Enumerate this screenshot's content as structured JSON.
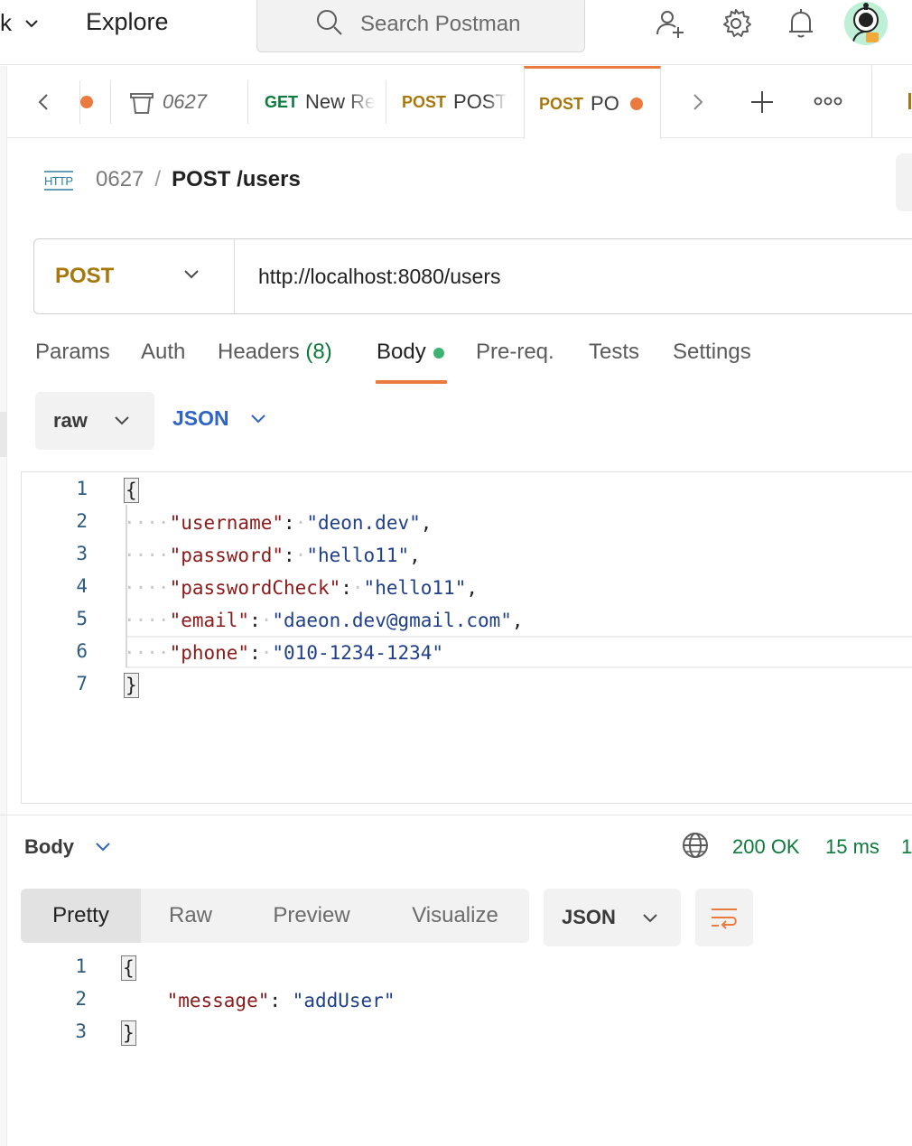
{
  "topbar": {
    "workspace_fragment": "k",
    "explore_label": "Explore",
    "search_placeholder": "Search Postman"
  },
  "tabs": [
    {
      "label": "0627"
    },
    {
      "method": "GET",
      "label": "New Re"
    },
    {
      "method": "POST",
      "label": "POST"
    },
    {
      "method": "POST",
      "label": "PO"
    }
  ],
  "breadcrumb": {
    "collection": "0627",
    "separator": "/",
    "request": "POST /users"
  },
  "request": {
    "method": "POST",
    "url": "http://localhost:8080/users"
  },
  "request_tabs": {
    "params": "Params",
    "auth": "Auth",
    "headers": "Headers",
    "headers_count": "(8)",
    "body": "Body",
    "prereq": "Pre-req.",
    "tests": "Tests",
    "settings": "Settings"
  },
  "body_mode": {
    "type": "raw",
    "language": "JSON"
  },
  "request_body": {
    "line_numbers": [
      "1",
      "2",
      "3",
      "4",
      "5",
      "6",
      "7"
    ],
    "open": "{",
    "close": "}",
    "fields": [
      {
        "key": "\"username\"",
        "value": "\"deon.dev\"",
        "comma": ","
      },
      {
        "key": "\"password\"",
        "value": "\"hello11\"",
        "comma": ","
      },
      {
        "key": "\"passwordCheck\"",
        "value": "\"hello11\"",
        "comma": ","
      },
      {
        "key": "\"email\"",
        "value": "\"daeon.dev@gmail.com\"",
        "comma": ","
      },
      {
        "key": "\"phone\"",
        "value": "\"010-1234-1234\"",
        "comma": ""
      }
    ]
  },
  "response": {
    "title": "Body",
    "status": "200 OK",
    "time": "15 ms",
    "size_fragment": "1",
    "view_tabs": [
      "Pretty",
      "Raw",
      "Preview",
      "Visualize"
    ],
    "format": "JSON",
    "line_numbers": [
      "1",
      "2",
      "3"
    ],
    "open": "{",
    "close": "}",
    "key": "\"message\"",
    "value": "\"addUser\""
  },
  "colors": {
    "accent": "#eb7a3e",
    "get": "#0b7a3a",
    "post": "#a6780c",
    "json_link": "#2f64c7",
    "success": "#0b7a3a"
  }
}
